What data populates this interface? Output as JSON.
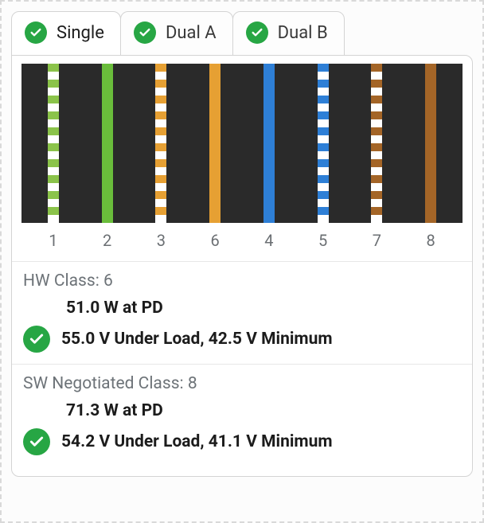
{
  "tabs": {
    "items": [
      {
        "label": "Single",
        "active": true
      },
      {
        "label": "Dual A",
        "active": false
      },
      {
        "label": "Dual B",
        "active": false
      }
    ]
  },
  "wires": {
    "labels": [
      "1",
      "2",
      "3",
      "6",
      "4",
      "5",
      "7",
      "8"
    ],
    "defs": [
      {
        "striped": true,
        "color": "lime"
      },
      {
        "striped": false,
        "color": "green"
      },
      {
        "striped": true,
        "color": "orange"
      },
      {
        "striped": false,
        "color": "orange"
      },
      {
        "striped": false,
        "color": "blue"
      },
      {
        "striped": true,
        "color": "blue"
      },
      {
        "striped": true,
        "color": "brown"
      },
      {
        "striped": false,
        "color": "brown"
      }
    ]
  },
  "sections": {
    "hw": {
      "title": "HW Class: 6",
      "power": "51.0 W at PD",
      "volts": "55.0 V Under Load, 42.5 V Minimum"
    },
    "sw": {
      "title": "SW Negotiated Class: 8",
      "power": "71.3 W at PD",
      "volts": "54.2 V Under Load, 41.1 V Minimum"
    }
  },
  "icons": {
    "check": "check-icon"
  }
}
